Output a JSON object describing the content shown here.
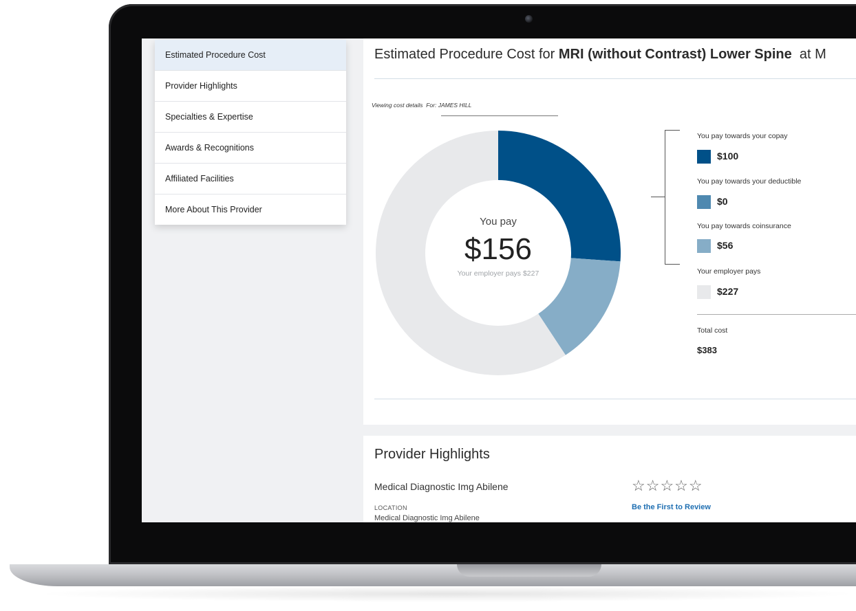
{
  "sidebar": {
    "items": [
      {
        "label": "Estimated Procedure Cost",
        "active": true
      },
      {
        "label": "Provider Highlights"
      },
      {
        "label": "Specialties & Expertise"
      },
      {
        "label": "Awards & Recognitions"
      },
      {
        "label": "Affiliated Facilities"
      },
      {
        "label": "More About This Provider"
      }
    ]
  },
  "cost": {
    "title_prefix": "Estimated Procedure Cost for ",
    "procedure": "MRI (without Contrast) Lower Spine",
    "title_suffix": "  at M",
    "viewing_label": "Viewing cost details",
    "viewing_for": "For: JAMES HILL",
    "center_label": "You pay",
    "center_value": "$156",
    "center_sub": "Your employer pays $227",
    "breakdown": [
      {
        "label": "You pay towards your copay",
        "value": "$100",
        "amount": 100,
        "color": "#005088"
      },
      {
        "label": "You pay towards your deductible",
        "value": "$0",
        "amount": 0,
        "color": "#4f89b0"
      },
      {
        "label": "You pay towards coinsurance",
        "value": "$56",
        "amount": 56,
        "color": "#86adc7"
      },
      {
        "label": "Your employer pays",
        "value": "$227",
        "amount": 227,
        "color": "#e8e9eb"
      }
    ],
    "total_label": "Total cost",
    "total_value": "$383"
  },
  "highlights": {
    "title": "Provider Highlights",
    "provider_name": "Medical Diagnostic Img Abilene",
    "location_label": "LOCATION",
    "location_value": "Medical Diagnostic Img Abilene",
    "stars": "☆☆☆☆☆",
    "rating": 0,
    "review_link": "Be the First to Review"
  }
}
